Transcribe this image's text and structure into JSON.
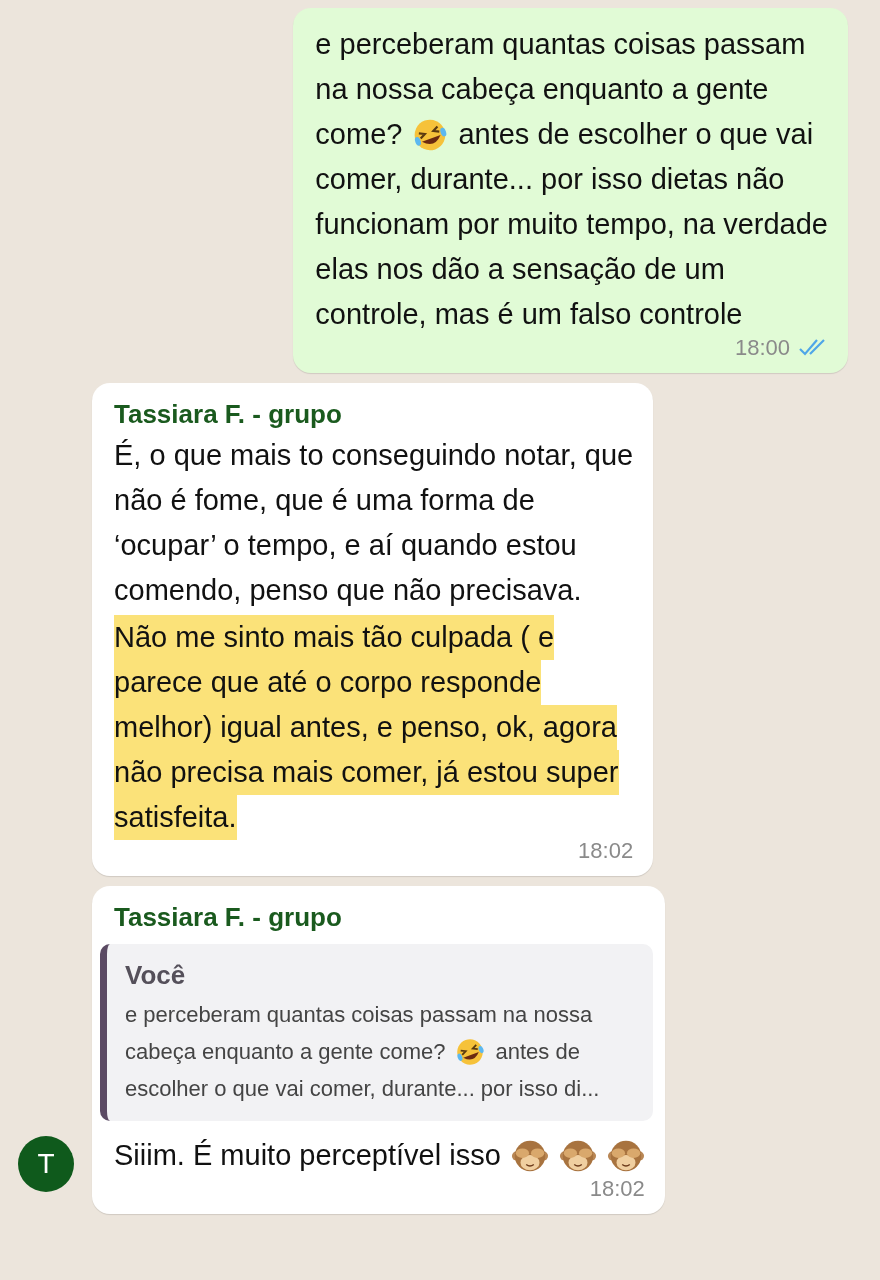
{
  "messages": [
    {
      "kind": "outgoing",
      "paragraphs": [
        {
          "highlighted": false,
          "lines": [
            [
              {
                "kind": "text",
                "text": "e perceberam quantas coisas passam"
              }
            ],
            [
              {
                "kind": "text",
                "text": "na nossa cabeça enquanto a gente"
              }
            ],
            [
              {
                "kind": "text",
                "text": "come?"
              },
              {
                "kind": "laugh"
              },
              {
                "kind": "text",
                "text": "antes de escolher o que vai"
              }
            ],
            [
              {
                "kind": "text",
                "text": "comer, durante... por isso dietas não"
              }
            ],
            [
              {
                "kind": "text",
                "text": "funcionam por muito tempo, na verdade"
              }
            ],
            [
              {
                "kind": "text",
                "text": "elas nos dão a sensação de um"
              }
            ],
            [
              {
                "kind": "text",
                "text": "controle, mas é um falso controle"
              }
            ]
          ]
        }
      ],
      "time": "18:00",
      "read": true
    },
    {
      "kind": "incoming",
      "sender": "Tassiara F. - grupo",
      "paragraphs": [
        {
          "highlighted": false,
          "lines": [
            [
              {
                "kind": "text",
                "text": "É, o que mais to conseguindo notar, que"
              }
            ],
            [
              {
                "kind": "text",
                "text": "não é fome, que é uma forma de"
              }
            ],
            [
              {
                "kind": "text",
                "text": "‘ocupar’ o tempo, e aí quando estou"
              }
            ],
            [
              {
                "kind": "text",
                "text": "comendo, penso que não precisava."
              }
            ]
          ]
        },
        {
          "highlighted": true,
          "lines": [
            [
              {
                "kind": "text",
                "text": "Não me sinto mais tão culpada ( e"
              }
            ],
            [
              {
                "kind": "text",
                "text": "parece que até o corpo responde"
              }
            ],
            [
              {
                "kind": "text",
                "text": "melhor) igual antes, e penso, ok, agora"
              }
            ],
            [
              {
                "kind": "text",
                "text": "não precisa mais comer, já estou super"
              }
            ],
            [
              {
                "kind": "text",
                "text": "satisfeita."
              }
            ]
          ]
        }
      ],
      "time": "18:02"
    },
    {
      "kind": "incoming",
      "sender": "Tassiara F. - grupo",
      "avatar": "T",
      "quote": {
        "author": "Você",
        "lines": [
          [
            {
              "kind": "text",
              "text": "e perceberam quantas coisas passam na nossa"
            }
          ],
          [
            {
              "kind": "text",
              "text": "cabeça enquanto a gente come?"
            },
            {
              "kind": "laugh"
            },
            {
              "kind": "text",
              "text": "antes de"
            }
          ],
          [
            {
              "kind": "text",
              "text": "escolher o que vai comer, durante... por isso di..."
            }
          ]
        ]
      },
      "paragraphs": [
        {
          "highlighted": false,
          "lines": [
            [
              {
                "kind": "text",
                "text": "Siiim. É muito perceptível isso"
              },
              {
                "kind": "monkey"
              },
              {
                "kind": "monkey"
              },
              {
                "kind": "monkey"
              }
            ]
          ]
        }
      ],
      "time": "18:02"
    }
  ]
}
